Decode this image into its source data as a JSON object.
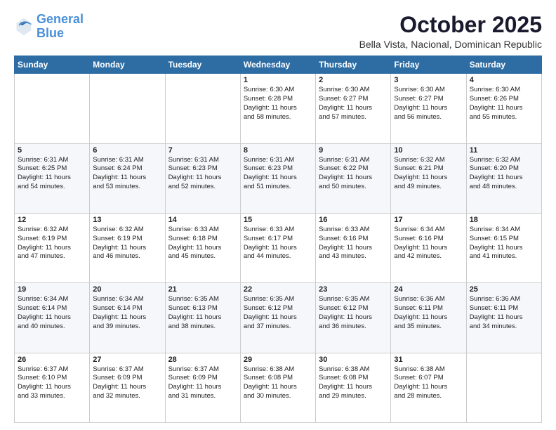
{
  "header": {
    "logo_line1": "General",
    "logo_line2": "Blue",
    "title": "October 2025",
    "subtitle": "Bella Vista, Nacional, Dominican Republic"
  },
  "days_of_week": [
    "Sunday",
    "Monday",
    "Tuesday",
    "Wednesday",
    "Thursday",
    "Friday",
    "Saturday"
  ],
  "weeks": [
    [
      {
        "day": "",
        "text": ""
      },
      {
        "day": "",
        "text": ""
      },
      {
        "day": "",
        "text": ""
      },
      {
        "day": "1",
        "text": "Sunrise: 6:30 AM\nSunset: 6:28 PM\nDaylight: 11 hours\nand 58 minutes."
      },
      {
        "day": "2",
        "text": "Sunrise: 6:30 AM\nSunset: 6:27 PM\nDaylight: 11 hours\nand 57 minutes."
      },
      {
        "day": "3",
        "text": "Sunrise: 6:30 AM\nSunset: 6:27 PM\nDaylight: 11 hours\nand 56 minutes."
      },
      {
        "day": "4",
        "text": "Sunrise: 6:30 AM\nSunset: 6:26 PM\nDaylight: 11 hours\nand 55 minutes."
      }
    ],
    [
      {
        "day": "5",
        "text": "Sunrise: 6:31 AM\nSunset: 6:25 PM\nDaylight: 11 hours\nand 54 minutes."
      },
      {
        "day": "6",
        "text": "Sunrise: 6:31 AM\nSunset: 6:24 PM\nDaylight: 11 hours\nand 53 minutes."
      },
      {
        "day": "7",
        "text": "Sunrise: 6:31 AM\nSunset: 6:23 PM\nDaylight: 11 hours\nand 52 minutes."
      },
      {
        "day": "8",
        "text": "Sunrise: 6:31 AM\nSunset: 6:23 PM\nDaylight: 11 hours\nand 51 minutes."
      },
      {
        "day": "9",
        "text": "Sunrise: 6:31 AM\nSunset: 6:22 PM\nDaylight: 11 hours\nand 50 minutes."
      },
      {
        "day": "10",
        "text": "Sunrise: 6:32 AM\nSunset: 6:21 PM\nDaylight: 11 hours\nand 49 minutes."
      },
      {
        "day": "11",
        "text": "Sunrise: 6:32 AM\nSunset: 6:20 PM\nDaylight: 11 hours\nand 48 minutes."
      }
    ],
    [
      {
        "day": "12",
        "text": "Sunrise: 6:32 AM\nSunset: 6:19 PM\nDaylight: 11 hours\nand 47 minutes."
      },
      {
        "day": "13",
        "text": "Sunrise: 6:32 AM\nSunset: 6:19 PM\nDaylight: 11 hours\nand 46 minutes."
      },
      {
        "day": "14",
        "text": "Sunrise: 6:33 AM\nSunset: 6:18 PM\nDaylight: 11 hours\nand 45 minutes."
      },
      {
        "day": "15",
        "text": "Sunrise: 6:33 AM\nSunset: 6:17 PM\nDaylight: 11 hours\nand 44 minutes."
      },
      {
        "day": "16",
        "text": "Sunrise: 6:33 AM\nSunset: 6:16 PM\nDaylight: 11 hours\nand 43 minutes."
      },
      {
        "day": "17",
        "text": "Sunrise: 6:34 AM\nSunset: 6:16 PM\nDaylight: 11 hours\nand 42 minutes."
      },
      {
        "day": "18",
        "text": "Sunrise: 6:34 AM\nSunset: 6:15 PM\nDaylight: 11 hours\nand 41 minutes."
      }
    ],
    [
      {
        "day": "19",
        "text": "Sunrise: 6:34 AM\nSunset: 6:14 PM\nDaylight: 11 hours\nand 40 minutes."
      },
      {
        "day": "20",
        "text": "Sunrise: 6:34 AM\nSunset: 6:14 PM\nDaylight: 11 hours\nand 39 minutes."
      },
      {
        "day": "21",
        "text": "Sunrise: 6:35 AM\nSunset: 6:13 PM\nDaylight: 11 hours\nand 38 minutes."
      },
      {
        "day": "22",
        "text": "Sunrise: 6:35 AM\nSunset: 6:12 PM\nDaylight: 11 hours\nand 37 minutes."
      },
      {
        "day": "23",
        "text": "Sunrise: 6:35 AM\nSunset: 6:12 PM\nDaylight: 11 hours\nand 36 minutes."
      },
      {
        "day": "24",
        "text": "Sunrise: 6:36 AM\nSunset: 6:11 PM\nDaylight: 11 hours\nand 35 minutes."
      },
      {
        "day": "25",
        "text": "Sunrise: 6:36 AM\nSunset: 6:11 PM\nDaylight: 11 hours\nand 34 minutes."
      }
    ],
    [
      {
        "day": "26",
        "text": "Sunrise: 6:37 AM\nSunset: 6:10 PM\nDaylight: 11 hours\nand 33 minutes."
      },
      {
        "day": "27",
        "text": "Sunrise: 6:37 AM\nSunset: 6:09 PM\nDaylight: 11 hours\nand 32 minutes."
      },
      {
        "day": "28",
        "text": "Sunrise: 6:37 AM\nSunset: 6:09 PM\nDaylight: 11 hours\nand 31 minutes."
      },
      {
        "day": "29",
        "text": "Sunrise: 6:38 AM\nSunset: 6:08 PM\nDaylight: 11 hours\nand 30 minutes."
      },
      {
        "day": "30",
        "text": "Sunrise: 6:38 AM\nSunset: 6:08 PM\nDaylight: 11 hours\nand 29 minutes."
      },
      {
        "day": "31",
        "text": "Sunrise: 6:38 AM\nSunset: 6:07 PM\nDaylight: 11 hours\nand 28 minutes."
      },
      {
        "day": "",
        "text": ""
      }
    ]
  ]
}
